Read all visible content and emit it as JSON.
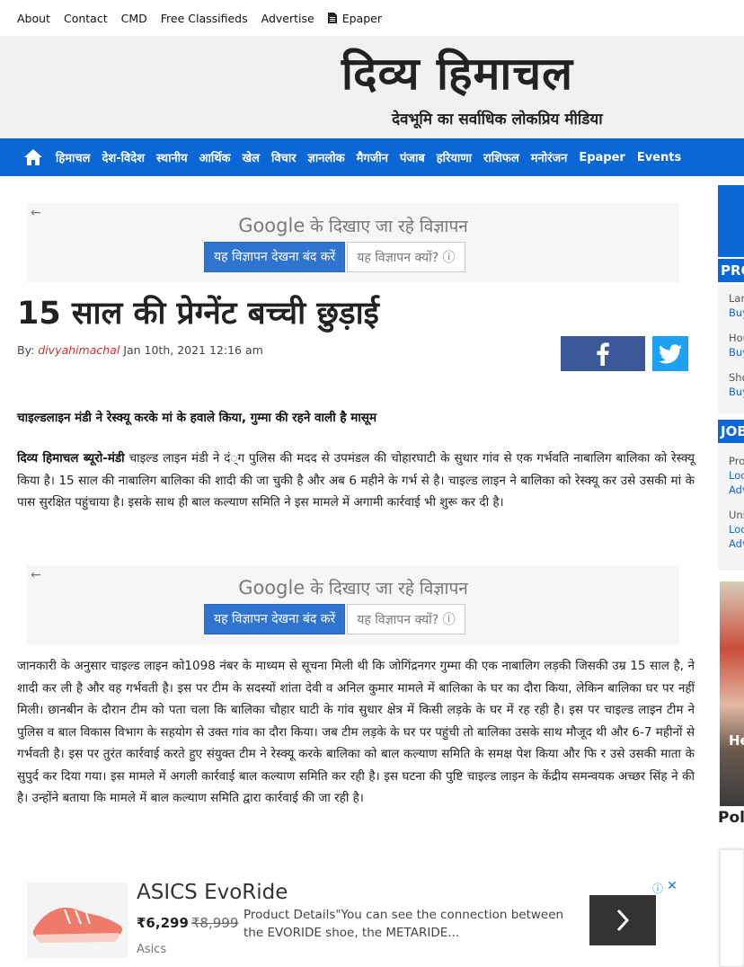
{
  "toplinks": {
    "items": [
      "About",
      "Contact",
      "CMD",
      "Free Classifieds",
      "Advertise"
    ],
    "epaper": "Epaper"
  },
  "masthead": {
    "logo": "दिव्य हिमाचल",
    "tagline": "देवभूमि का सर्वाधिक लोकप्रिय मीडिया"
  },
  "nav": {
    "items": [
      "हिमाचल",
      "देश-विदेश",
      "स्थानीय",
      "आर्थिक",
      "खेल",
      "विचार",
      "ज्ञानलोक",
      "मैगजीन",
      "पंजाब",
      "हरियाणा",
      "राशिफल",
      "मनोरंजन",
      "Epaper",
      "Events"
    ]
  },
  "ad": {
    "google": "Google",
    "shown_by": "के दिखाए जा रहे विज्ञापन",
    "stop_label": "यह विज्ञापन देखना बंद करें",
    "why_label": "यह विज्ञापन क्यों?",
    "back": "←"
  },
  "article": {
    "headline": "15 साल की प्रेग्नेंट बच्ची छुड़ाई",
    "by_label": "By:",
    "author": "divyahimachal",
    "date": "Jan 10th, 2021 12:16 am",
    "subhead": "चाइल्डलाइन मंडी ने रेस्क्यू करके मां के हवाले किया, गुम्मा की रहने वाली है मासूम",
    "p1_lead": "दिव्य हिमाचल ब्यूरो-मंडी",
    "p1_body": " चाइल्ड लाइन मंडी ने दं्ग पुलिस की मदद से उपमंडल की चोहारघाटी के सुधार गांव से एक गर्भवति नाबालिग बालिका को रेस्क्यू किया है। 15 साल की नाबालिग बालिका की शादी की जा चुकी है और अब 6 महीने के गर्भ से है। चाइल्ड लाइन ने बालिका को रेस्क्यू कर उसे उसकी मां के पास सुरक्षित पहुंचाया है। इसके साथ ही बाल कल्याण समिति ने इस मामले में अगामी कार्रवाई भी शुरू कर दी है।",
    "p2": "जानकारी के अनुसार चाइल्ड लाइन को1098 नंबर के माध्यम से सूचना मिली थी कि जोगिंद्रनगर गुम्मा की एक नाबालिग लड़की जिसकी उम्र 15 साल है, ने शादी कर ली है और वह गर्भवती है। इस पर टीम के सदस्यों शांता देवी व अनिल कुमार मामले में बालिका के घर का दौरा किया, लेकिन बालिका घर पर नहीं मिली। छानबीन के दौरान टीम को पता चला कि बालिका चौहार घाटी के गांव सुधार क्षेत्र में किसी लड़के के घर में रह रही है। इस पर चाइल्ड लाइन टीम ने पुलिस व बाल विकास विभाग के सहयोग से उक्त गांव का दौरा किया। जब टीम लड़के के घर पर पहुंची तो बालिका उसके साथ मौजूद थी और 6-7 महीनों से गर्भवती है। इस पर तुरंत कार्रवाई करते हुए संयुक्त टीम ने रेस्क्यू करके बालिका को बाल कल्याण समिति के समक्ष पेश किया और फि र उसे उसकी माता के सुपुर्द कर दिया गया। इस मामले में अगली कार्रवाई बाल कल्याण समिति कर रही है। इस घटना की पुष्टि चाइल्ड लाइन के केंद्रीय समन्वयक अच्छर सिंह ने की है। उन्होंने बताया कि मामले में बाल कल्याण समिति द्वारा कार्रवाई की जा रही है।"
  },
  "bottom_ad": {
    "title": "ASICS EvoRide",
    "price": "₹6,299",
    "old_price": "₹8,999",
    "brand": "Asics",
    "desc": "Product Details\"You can see the connection between the EVORIDE shoe, the METARIDE..."
  },
  "sidebar": {
    "pro_header": "PRO",
    "pro_items": [
      {
        "label": "Lar",
        "link": "Buy"
      },
      {
        "label": "Hou",
        "link": "Buy"
      },
      {
        "label": "Sho",
        "link": "Buy"
      }
    ],
    "job_header": "JOB",
    "job_items": [
      {
        "label": "Pro",
        "link1": "Loc",
        "link2": "Adv"
      },
      {
        "label": "Uns",
        "link1": "Loc",
        "link2": "Adv"
      }
    ],
    "image_text": "He",
    "poli": "Poli"
  },
  "colors": {
    "nav_blue": "#0b66d6",
    "author_red": "#d2312f",
    "facebook": "#3b5998",
    "twitter": "#1da1f2"
  }
}
